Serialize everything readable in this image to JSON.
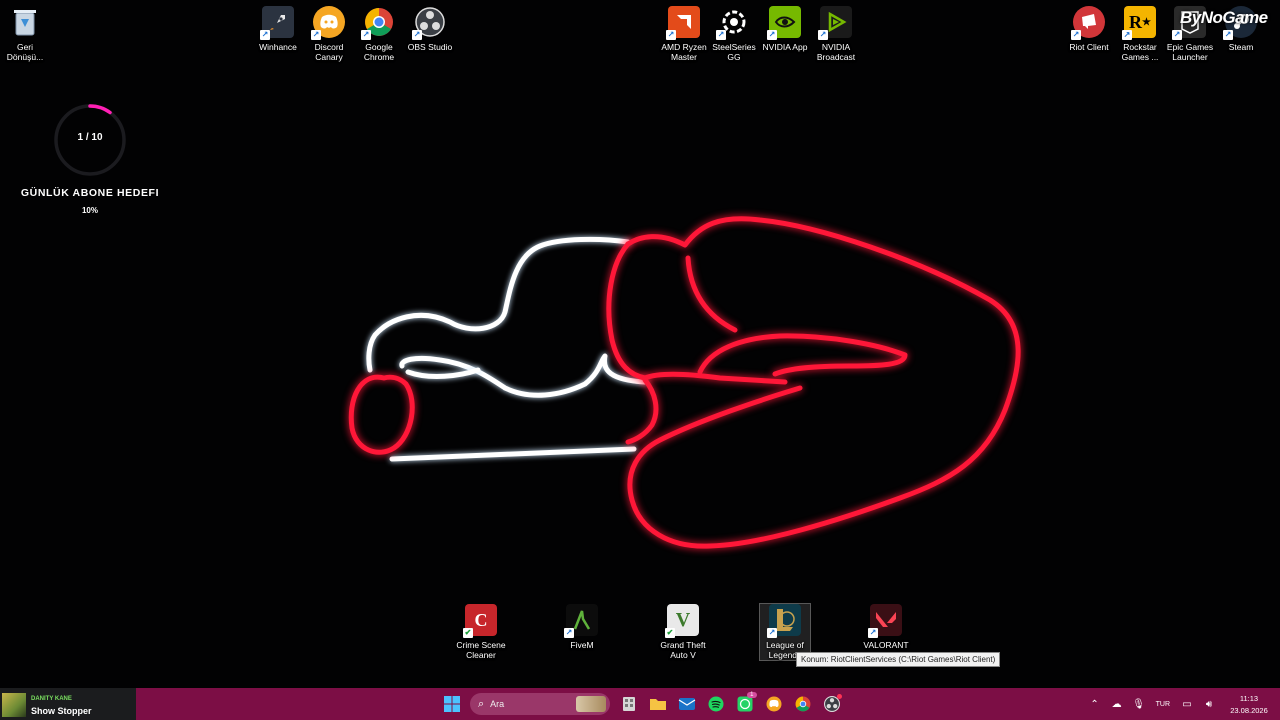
{
  "desktop": {
    "icons_top_left": [
      {
        "label": "Geri\nDönüşü...",
        "icon": "recycle-bin-icon",
        "color": "#9fb4c8"
      },
      {
        "label": "Winhance",
        "icon": "rocket-icon",
        "color": "#2b3340"
      },
      {
        "label": "Discord\nCanary",
        "icon": "discord-icon",
        "color": "#f5a623"
      },
      {
        "label": "Google\nChrome",
        "icon": "chrome-icon",
        "color": "#4285f4"
      },
      {
        "label": "OBS Studio",
        "icon": "obs-icon",
        "color": "#3b3f45"
      }
    ],
    "icons_top_mid": [
      {
        "label": "AMD Ryzen\nMaster",
        "icon": "amd-icon",
        "color": "#e34b1a"
      },
      {
        "label": "SteelSeries\nGG",
        "icon": "steelseries-icon",
        "color": "#111111"
      },
      {
        "label": "NVIDIA App",
        "icon": "nvidia-icon",
        "color": "#76b900"
      },
      {
        "label": "NVIDIA\nBroadcast",
        "icon": "nvidia-broadcast-icon",
        "color": "#1a1a1a"
      }
    ],
    "icons_top_right": [
      {
        "label": "Riot Client",
        "icon": "riot-icon",
        "color": "#d13639"
      },
      {
        "label": "Rockstar\nGames ...",
        "icon": "rockstar-icon",
        "color": "#f4b400"
      },
      {
        "label": "Epic Games\nLauncher",
        "icon": "epic-icon",
        "color": "#2a2a2a"
      },
      {
        "label": "Steam",
        "icon": "steam-icon",
        "color": "#1b2838"
      }
    ],
    "icons_bottom": [
      {
        "label": "Crime Scene\nCleaner",
        "icon": "crime-scene-icon",
        "color": "#c7262b"
      },
      {
        "label": "FiveM",
        "icon": "fivem-icon",
        "color": "#1d2a12"
      },
      {
        "label": "Grand Theft\nAuto V",
        "icon": "gta-icon",
        "color": "#f0f0f0"
      },
      {
        "label": "League of\nLegends",
        "icon": "league-icon",
        "color": "#0e3b4a"
      },
      {
        "label": "VALORANT",
        "icon": "valorant-icon",
        "color": "#fa4454"
      }
    ],
    "watermark": "ByNoGame",
    "tooltip": "Konum: RiotClientServices (C:\\Riot Games\\Riot Client)"
  },
  "widget": {
    "count": "1 / 10",
    "title": "GÜNLÜK ABONE HEDEFI",
    "percent_label": "10%",
    "progress": 0.1,
    "accent": "#ff1fb4"
  },
  "taskbar": {
    "color": "#7c0e45",
    "media": {
      "artist": "DANITY KANE",
      "title": "Show Stopper"
    },
    "search_label": "Ara",
    "apps": [
      "widgets-icon",
      "file-explorer-icon",
      "outlook-icon",
      "spotify-icon",
      "whatsapp-icon",
      "discord-canary-icon",
      "chrome-icon",
      "obs-icon"
    ],
    "whatsapp_badge": "1",
    "tray": {
      "language": "TUR",
      "time": "11:13",
      "date": "23.08.2026"
    }
  }
}
